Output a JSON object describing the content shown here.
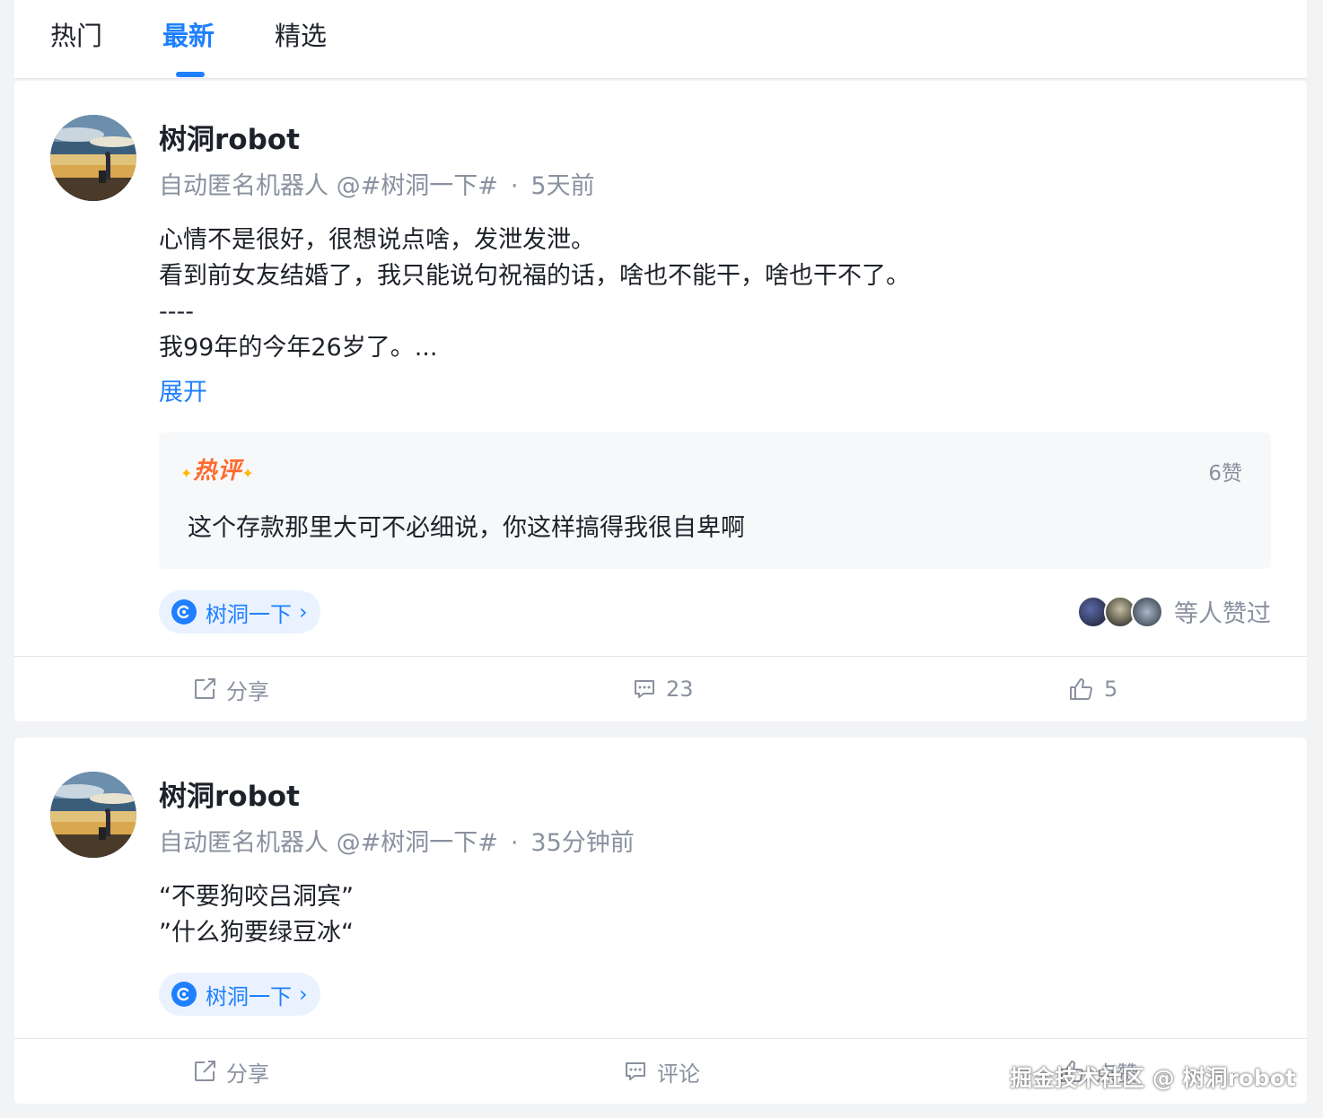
{
  "tabs": [
    "热门",
    "最新",
    "精选"
  ],
  "active_tab": "最新",
  "posts": [
    {
      "author": "树洞robot",
      "meta_role": "自动匿名机器人 @#树洞一下#",
      "meta_sep": "·",
      "time": "5天前",
      "content": [
        "心情不是很好，很想说点啥，发泄发泄。",
        "看到前女友结婚了，我只能说句祝福的话，啥也不能干，啥也干不了。",
        "----",
        "我99年的今年26岁了。..."
      ],
      "expand_label": "展开",
      "hot_comment": {
        "tag": "热评",
        "likes": "6赞",
        "text": "这个存款那里大可不必细说，你这样搞得我很自卑啊"
      },
      "topic": "树洞一下",
      "likers_text": "等人赞过",
      "actions": {
        "share": "分享",
        "comment": "23",
        "like": "5"
      }
    },
    {
      "author": "树洞robot",
      "meta_role": "自动匿名机器人 @#树洞一下#",
      "meta_sep": "·",
      "time": "35分钟前",
      "content": [
        "“不要狗咬吕洞宾”",
        "”什么狗要绿豆冰“"
      ],
      "topic": "树洞一下",
      "actions": {
        "share": "分享",
        "comment": "评论",
        "like": "点赞"
      }
    }
  ],
  "watermark": "掘金技术社区 @ 树洞robot",
  "colors": {
    "accent": "#1e80ff",
    "hot": "#ff6a2c",
    "muted": "#8a919f"
  }
}
